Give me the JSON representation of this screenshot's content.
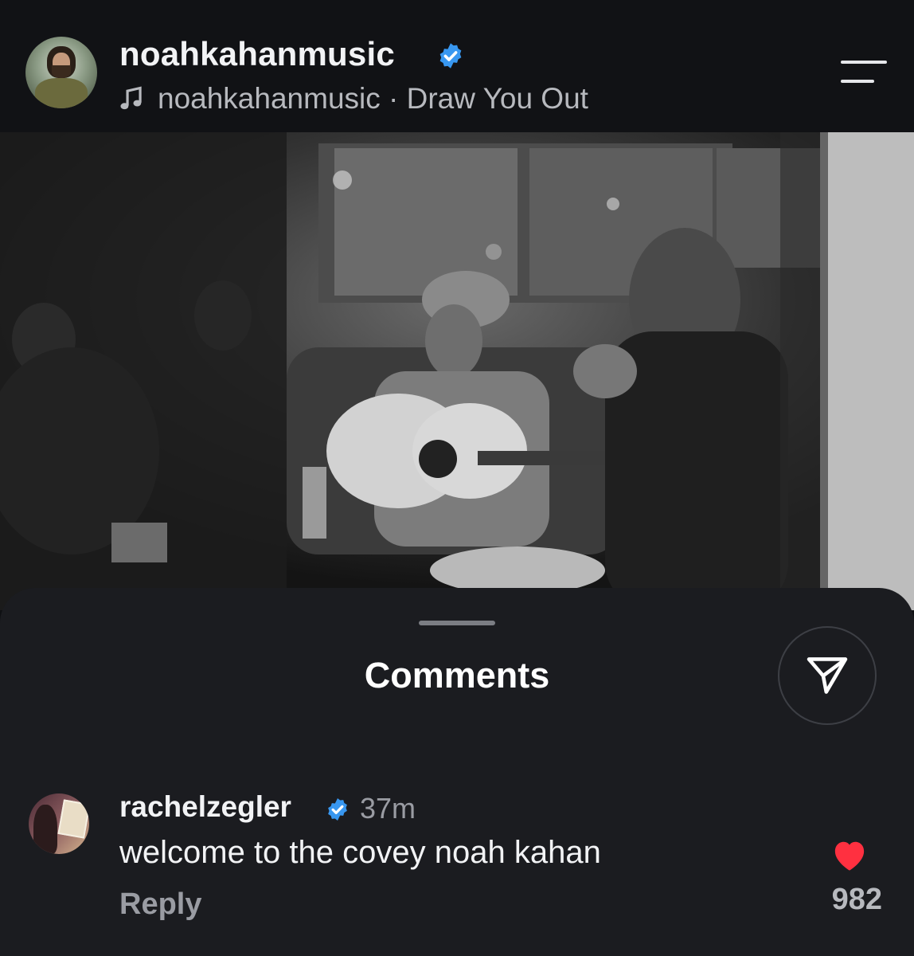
{
  "post": {
    "username": "noahkahanmusic",
    "audio_artist": "noahkahanmusic",
    "audio_separator": " · ",
    "audio_title": "Draw You Out"
  },
  "icons": {
    "verified": "verified-badge-icon",
    "music": "music-note-icon",
    "menu": "menu-icon",
    "share": "send-icon",
    "like": "heart-icon"
  },
  "colors": {
    "verified_blue": "#3897f0",
    "like_red": "#ff3040",
    "sheet_bg": "#1b1c20"
  },
  "comments_sheet": {
    "title": "Comments"
  },
  "comment": {
    "username": "rachelzegler",
    "time": "37m",
    "text": "welcome to the covey noah kahan",
    "reply_label": "Reply",
    "like_count": "982"
  }
}
